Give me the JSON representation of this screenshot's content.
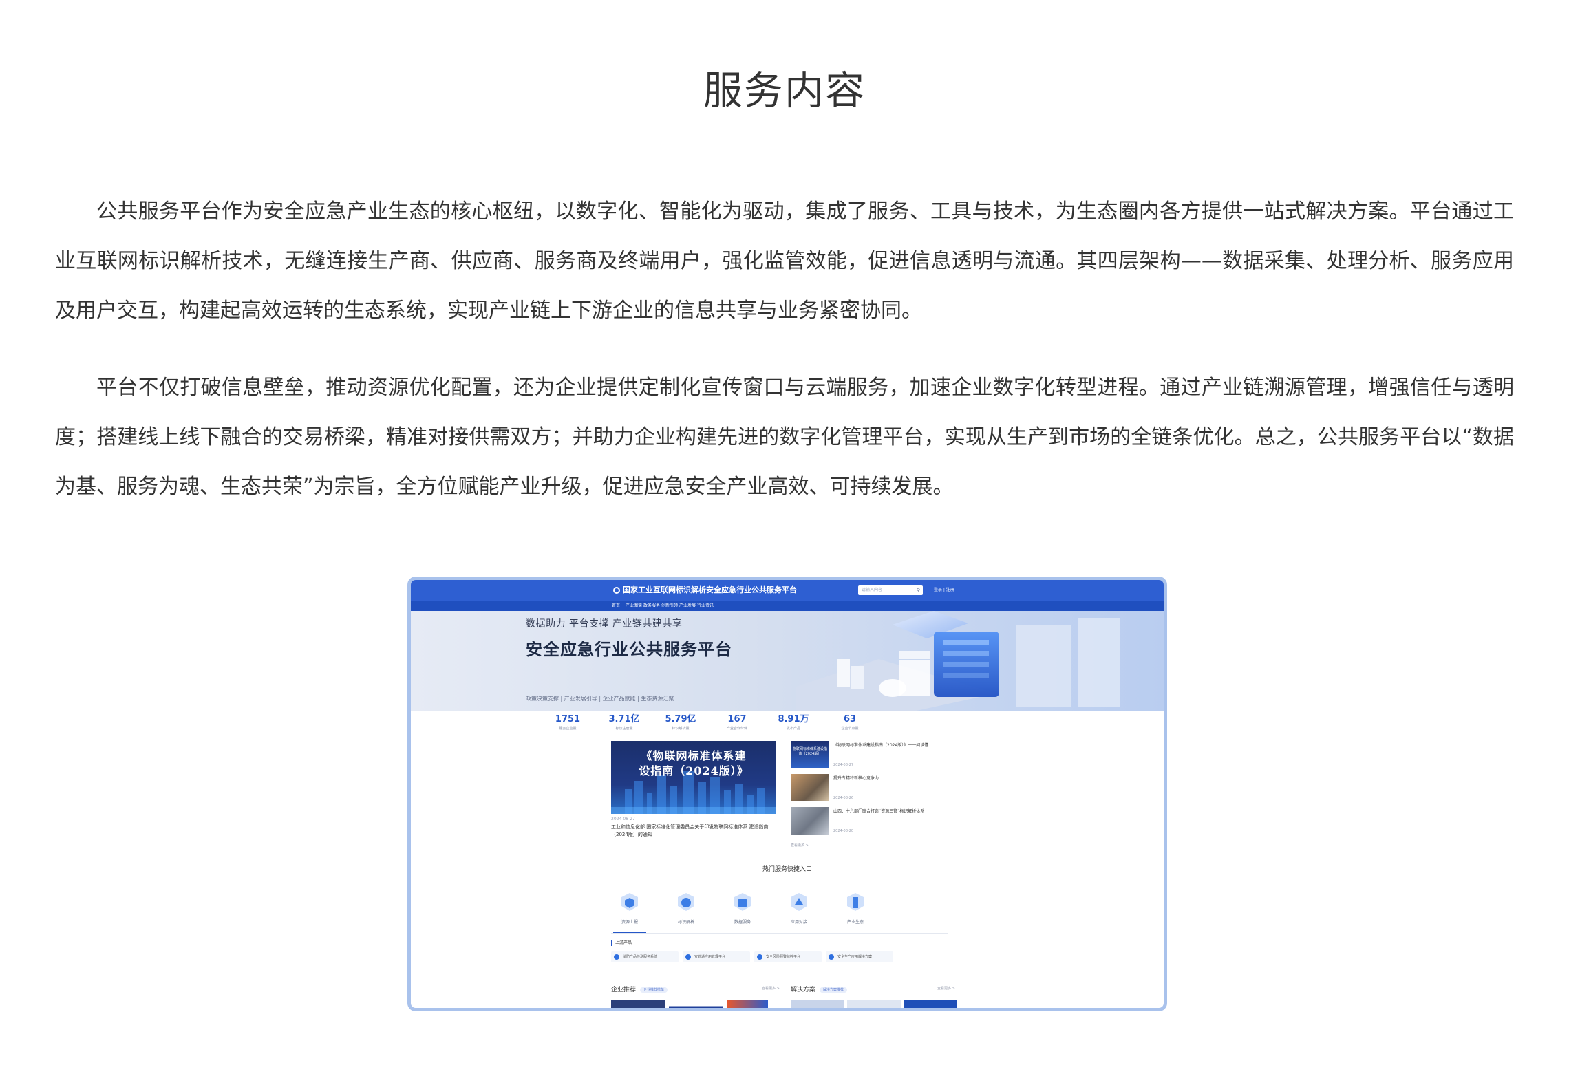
{
  "section": {
    "title": "服务内容",
    "paragraphs": [
      "公共服务平台作为安全应急产业生态的核心枢纽，以数字化、智能化为驱动，集成了服务、工具与技术，为生态圈内各方提供一站式解决方案。平台通过工业互联网标识解析技术，无缝连接生产商、供应商、服务商及终端用户，强化监管效能，促进信息透明与流通。其四层架构——数据采集、处理分析、服务应用及用户交互，构建起高效运转的生态系统，实现产业链上下游企业的信息共享与业务紧密协同。",
      "平台不仅打破信息壁垒，推动资源优化配置，还为企业提供定制化宣传窗口与云端服务，加速企业数字化转型进程。通过产业链溯源管理，增强信任与透明度；搭建线上线下融合的交易桥梁，精准对接供需双方；并助力企业构建先进的数字化管理平台，实现从生产到市场的全链条优化。总之，公共服务平台以“数据为基、服务为魂、生态共荣”为宗旨，全方位赋能产业升级，促进应急安全产业高效、可持续发展。"
    ]
  },
  "screenshot": {
    "header": {
      "site_title": "国家工业互联网标识解析安全应急行业公共服务平台",
      "search_placeholder": "请输入内容",
      "login_links": "登录 | 注册"
    },
    "nav": [
      "首页",
      "产业图谱",
      "政务服务",
      "创新引领",
      "产业发展",
      "行业资讯"
    ],
    "hero": {
      "subtitle": "数据助力  平台支撑  产业链共建共享",
      "title": "安全应急行业公共服务平台",
      "tags": "政策决策支撑  |  产业发展引导  |  企业产品赋能  |  生态资源汇聚"
    },
    "stats": [
      {
        "num": "1751",
        "label": "服务企业量"
      },
      {
        "num": "3.71亿",
        "label": "标识注册量"
      },
      {
        "num": "5.79亿",
        "label": "标识解析量"
      },
      {
        "num": "167",
        "label": "产业合作伙伴"
      },
      {
        "num": "8.91万",
        "label": "发布产品"
      },
      {
        "num": "63",
        "label": "企业节点量"
      }
    ],
    "news": {
      "main": {
        "cover_line1": "《物联网标准体系建",
        "cover_line2": "设指南（2024版）》",
        "date": "2024-08-27",
        "desc": "工业和信息化部 国家标准化管理委员会关于印发物联网标准体系 建设指南（2024版）的通知"
      },
      "thumb_title": "物联网标准体系建设指南（2024版）",
      "items": [
        {
          "title": "《物联网标准体系建设指南（2024版）》十一问读懂",
          "date": "2024-08-27"
        },
        {
          "title": "提升专精特新核心竞争力",
          "date": "2024-08-26"
        },
        {
          "title": "山西：十六部门联合打造“资源三管”标识解析体系",
          "date": "2024-08-20"
        }
      ],
      "more": "查看更多 >"
    },
    "services": {
      "title": "热门服务快捷入口",
      "items": [
        "资源上报",
        "标识解析",
        "数据服务",
        "应用对接",
        "产业生态"
      ]
    },
    "upstream": {
      "heading": "上游产品",
      "chips": [
        "消防产品检测服务系统",
        "安管通应用管理平台",
        "安全风险预警监控平台",
        "安全生产应用解决方案"
      ]
    },
    "sections": [
      {
        "title": "企业推荐",
        "pill": "企业推荐榜单",
        "more": "查看更多 >"
      },
      {
        "title": "解决方案",
        "pill": "解决方案推荐",
        "more": "查看更多 >"
      }
    ],
    "colors": {
      "brand_blue": "#2e5fd2",
      "nav_blue": "#1f4fbf",
      "accent": "#2557c8",
      "frame_border": "#a9c2ec"
    }
  }
}
